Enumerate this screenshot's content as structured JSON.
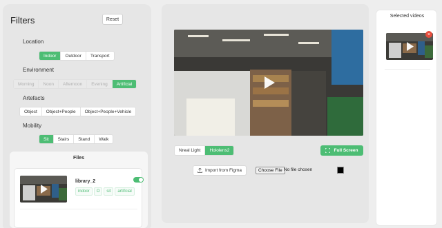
{
  "filters": {
    "title": "Filters",
    "reset_label": "Reset",
    "location": {
      "label": "Location",
      "options": [
        "Indoor",
        "Outdoor",
        "Transport"
      ],
      "selected": "Indoor"
    },
    "environment": {
      "label": "Environment",
      "options": [
        "Morning",
        "Noon",
        "Afternoon",
        "Evening",
        "Artificial"
      ],
      "selected": "Artificial",
      "disabled": true
    },
    "artefacts": {
      "label": "Artefacts",
      "options": [
        "Object",
        "Object+People",
        "Object+People+Vehicle"
      ],
      "selected": ""
    },
    "mobility": {
      "label": "Mobility",
      "options": [
        "Sit",
        "Stairs",
        "Stand",
        "Walk"
      ],
      "selected": "Sit"
    }
  },
  "files": {
    "title": "Files",
    "items": [
      {
        "name": "library_2",
        "tags": [
          "indoor",
          "O",
          "sit",
          "artificial"
        ],
        "enabled": true
      }
    ]
  },
  "player": {
    "sources": [
      "Nreal Light",
      "Hololens2"
    ],
    "selected_source": "Hololens2",
    "fullscreen_label": "Full Screen",
    "import_label": "Import from Figma",
    "choose_file_label": "Choose File",
    "no_file_label": "No file chosen",
    "color_value": "#000000"
  },
  "selected_videos": {
    "title": "Selected videos",
    "remove_glyph": "×"
  },
  "colors": {
    "accent": "#4dbd74",
    "danger": "#e74c3c"
  }
}
